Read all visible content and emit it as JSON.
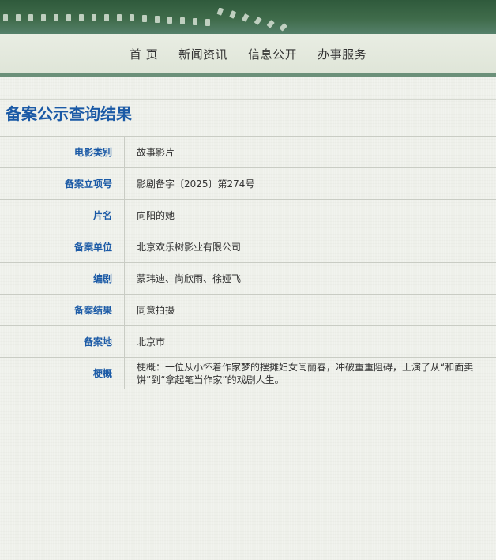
{
  "colors": {
    "banner_dark": "#2f5a3c",
    "nav_divider": "#6b9079",
    "accent_blue": "#1b5aa6",
    "text": "#333333"
  },
  "nav": {
    "items": [
      {
        "label": "首 页"
      },
      {
        "label": "新闻资讯"
      },
      {
        "label": "信息公开"
      },
      {
        "label": "办事服务"
      }
    ]
  },
  "page": {
    "title": "备案公示查询结果"
  },
  "record": {
    "rows": [
      {
        "label": "电影类别",
        "value": "故事影片"
      },
      {
        "label": "备案立项号",
        "value": "影剧备字〔2025〕第274号"
      },
      {
        "label": "片名",
        "value": "向阳的她"
      },
      {
        "label": "备案单位",
        "value": "北京欢乐树影业有限公司"
      },
      {
        "label": "编剧",
        "value": "蒙玮迪、尚欣雨、徐娅飞"
      },
      {
        "label": "备案结果",
        "value": "同意拍摄"
      },
      {
        "label": "备案地",
        "value": "北京市"
      },
      {
        "label": "梗概",
        "value": "梗概：一位从小怀着作家梦的摆摊妇女闫丽春，冲破重重阻碍，上演了从“和面卖饼”到“拿起笔当作家”的戏剧人生。"
      }
    ]
  }
}
